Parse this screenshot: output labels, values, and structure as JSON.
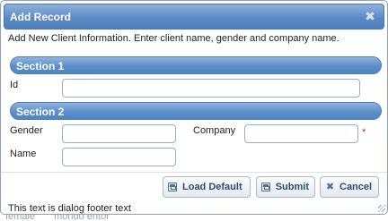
{
  "dialog": {
    "title": "Add Record",
    "close_glyph": "✖",
    "description": "Add New Client Information. Enter client name, gender and company name."
  },
  "sections": [
    {
      "label": "Section 1"
    },
    {
      "label": "Section 2"
    }
  ],
  "fields": {
    "id": {
      "label": "Id",
      "value": ""
    },
    "gender": {
      "label": "Gender",
      "value": ""
    },
    "company": {
      "label": "Company",
      "value": "",
      "required_mark": "*"
    },
    "name": {
      "label": "Name",
      "value": ""
    }
  },
  "buttons": {
    "load_default": {
      "label": "Load Default",
      "icon": "disk-icon"
    },
    "submit": {
      "label": "Submit",
      "icon": "disk-icon"
    },
    "cancel": {
      "label": "Cancel",
      "icon": "close-icon",
      "glyph": "✖"
    }
  },
  "footer": {
    "text": "This text is dialog footer text"
  },
  "background_page": {
    "cells": [
      "female",
      "mondo entor"
    ]
  },
  "colors": {
    "titlebar": "#5b8bc6",
    "section_bar": "#5d8ec9",
    "button_text": "#2b4d75",
    "required": "#cc2222"
  }
}
